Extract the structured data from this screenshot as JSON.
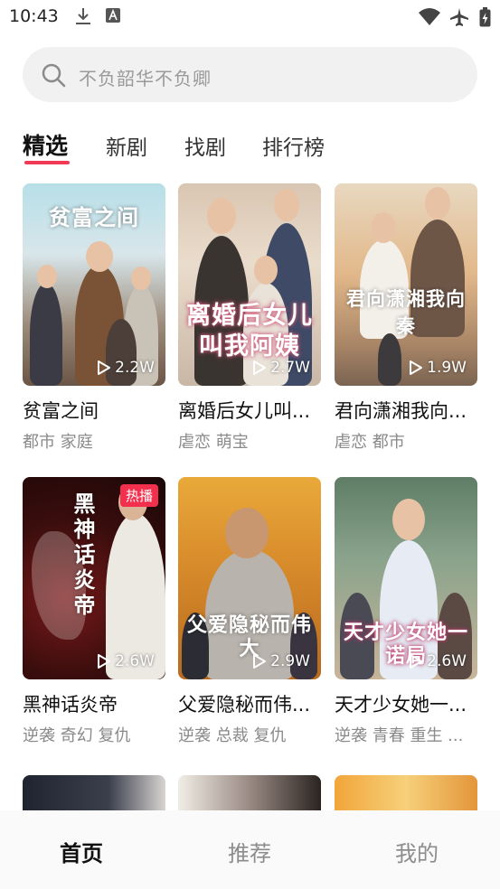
{
  "status_bar": {
    "time": "10:43"
  },
  "search": {
    "placeholder": "不负韶华不负卿"
  },
  "tabs": [
    {
      "label": "精选",
      "active": true
    },
    {
      "label": "新剧"
    },
    {
      "label": "找剧"
    },
    {
      "label": "排行榜"
    }
  ],
  "cards": [
    {
      "poster_title": "贫富之间",
      "views": "2.2W",
      "title": "贫富之间",
      "tags": "都市 家庭"
    },
    {
      "poster_title": "离婚后女儿叫我阿姨",
      "views": "2.7W",
      "title": "离婚后女儿叫...",
      "tags": "虐恋 萌宝"
    },
    {
      "poster_title": "君向潇湘我向秦",
      "views": "1.9W",
      "title": "君向潇湘我向...",
      "tags": "虐恋 都市"
    },
    {
      "poster_title": "黑神话炎帝",
      "views": "2.6W",
      "title": "黑神话炎帝",
      "tags": "逆袭 奇幻 复仇",
      "badge": "热播"
    },
    {
      "poster_title": "父爱隐秘而伟大",
      "views": "2.9W",
      "title": "父爱隐秘而伟...",
      "tags": "逆袭 总裁 复仇"
    },
    {
      "poster_title": "天才少女她一诺局",
      "views": "2.6W",
      "title": "天才少女她一...",
      "tags": "逆袭 青春 重生 ..."
    }
  ],
  "bottom_nav": [
    {
      "label": "首页",
      "active": true
    },
    {
      "label": "推荐"
    },
    {
      "label": "我的"
    }
  ],
  "colors": {
    "accent": "#f23a56",
    "badge": "#f2304e"
  }
}
